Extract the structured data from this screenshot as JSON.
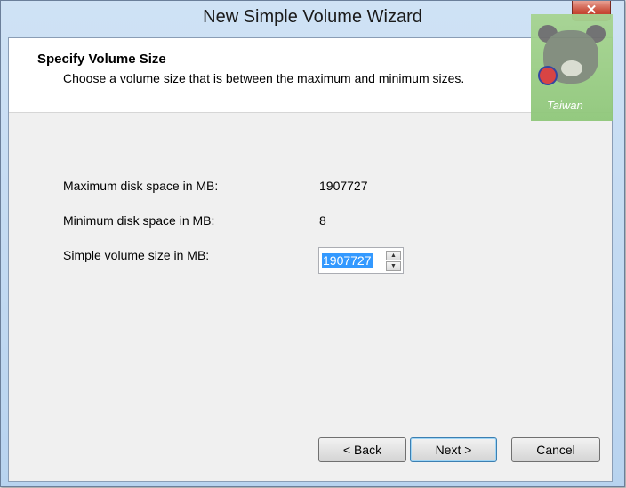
{
  "window": {
    "title": "New Simple Volume Wizard",
    "close_glyph": "✕"
  },
  "header": {
    "title": "Specify Volume Size",
    "subtitle": "Choose a volume size that is between the maximum and minimum sizes."
  },
  "watermark": {
    "text": "Taiwan"
  },
  "form": {
    "max_label": "Maximum disk space in MB:",
    "max_value": "1907727",
    "min_label": "Minimum disk space in MB:",
    "min_value": "8",
    "size_label": "Simple volume size in MB:",
    "size_value": "1907727",
    "spin_up_glyph": "▲",
    "spin_down_glyph": "▼"
  },
  "buttons": {
    "back": "< Back",
    "next": "Next >",
    "cancel": "Cancel"
  },
  "colors": {
    "selection": "#3399ff",
    "close_button": "#c84b37",
    "frame": "#b8d3ef"
  }
}
